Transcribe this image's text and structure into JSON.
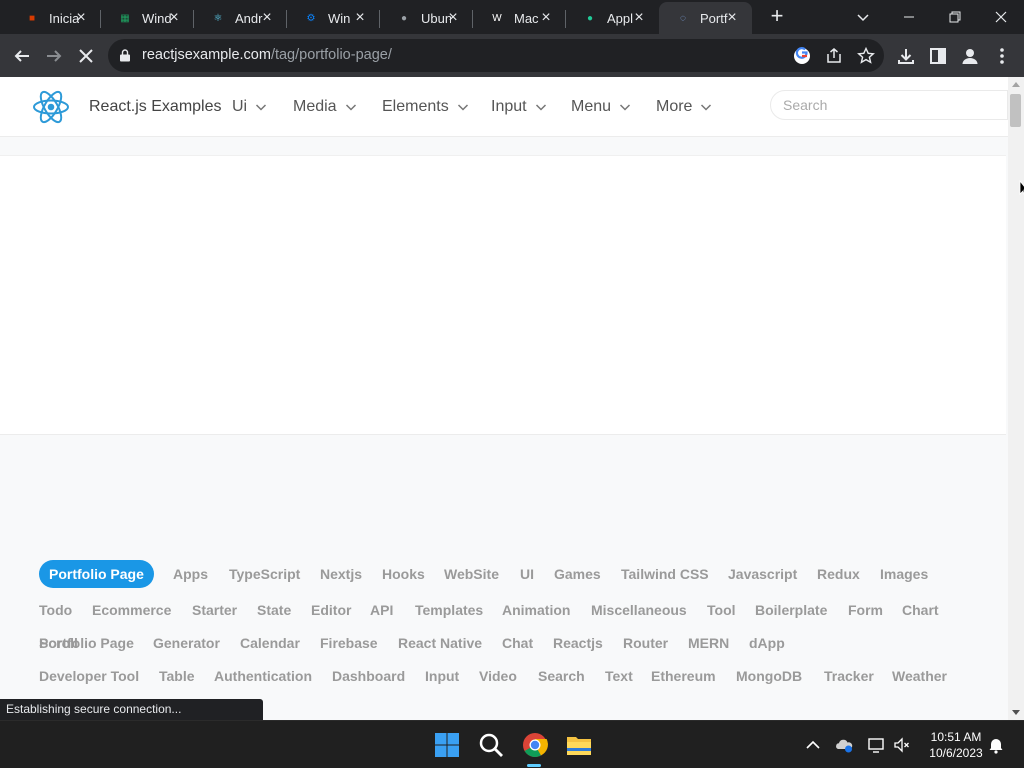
{
  "browser": {
    "tabs": [
      {
        "title": "Inicia",
        "icon": "office-icon",
        "color": "#d83b01",
        "active": false
      },
      {
        "title": "Wind",
        "icon": "spreadsheet-icon",
        "color": "#1fa463",
        "active": false
      },
      {
        "title": "Andr",
        "icon": "react-icon",
        "color": "#61dafb",
        "active": false
      },
      {
        "title": "Win",
        "icon": "gear-icon",
        "color": "#0a84ff",
        "active": false
      },
      {
        "title": "Ubun",
        "icon": "globe-icon",
        "color": "#9aa0a6",
        "active": false
      },
      {
        "title": "Mac",
        "icon": "wordpress-icon",
        "color": "#ffffff",
        "active": false
      },
      {
        "title": "Appl",
        "icon": "apple-icon",
        "color": "#20c997",
        "active": false
      },
      {
        "title": "Portf",
        "icon": "chrome-loading-icon",
        "color": "#8ab4f8",
        "active": true
      }
    ],
    "url_host": "reactjsexample.com",
    "url_path": "/tag/portfolio-page/",
    "status_text": "Establishing secure connection..."
  },
  "site": {
    "brand": "React.js Examples",
    "nav": [
      "Ui",
      "Media",
      "Elements",
      "Input",
      "Menu",
      "More"
    ],
    "search_placeholder": "Search"
  },
  "tags": {
    "rows": [
      [
        "Portfolio Page",
        "Apps",
        "TypeScript",
        "Nextjs",
        "Hooks",
        "WebSite",
        "UI",
        "Games",
        "Tailwind CSS",
        "Javascript",
        "Redux",
        "Images"
      ],
      [
        "Todo",
        "Ecommerce",
        "Starter",
        "State",
        "Editor",
        "API",
        "Templates",
        "Animation",
        "Miscellaneous",
        "Tool",
        "Boilerplate",
        "Form",
        "Chart"
      ],
      [
        "Portfolio Page",
        "Generator",
        "Calendar",
        "Firebase",
        "React Native",
        "Chat",
        "Reactjs",
        "Router",
        "MERN",
        "dApp",
        "Scroll"
      ],
      [
        "Developer Tool",
        "Table",
        "Authentication",
        "Dashboard",
        "Input",
        "Video",
        "Search",
        "Text",
        "Ethereum",
        "MongoDB",
        "Tracker",
        "Weather"
      ]
    ],
    "active": "Portfolio Page",
    "active_color": "#1a97e6"
  },
  "taskbar": {
    "time": "10:51 AM",
    "date": "10/6/2023"
  }
}
